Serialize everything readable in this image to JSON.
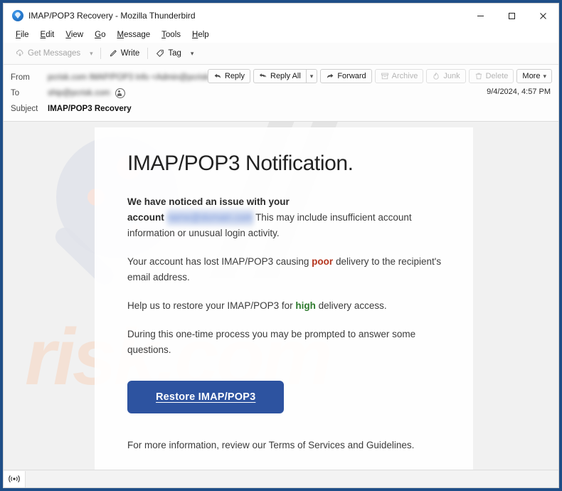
{
  "window": {
    "title": "IMAP/POP3 Recovery - Mozilla Thunderbird",
    "logo_icon": "thunderbird-logo-icon",
    "controls": {
      "minimize": "minimize-icon",
      "maximize": "maximize-icon",
      "close": "close-icon"
    }
  },
  "menubar": {
    "items": [
      {
        "label": "File",
        "mnemonic": "F",
        "rest": "ile"
      },
      {
        "label": "Edit",
        "mnemonic": "E",
        "rest": "dit"
      },
      {
        "label": "View",
        "mnemonic": "V",
        "rest": "iew"
      },
      {
        "label": "Go",
        "mnemonic": "G",
        "rest": "o"
      },
      {
        "label": "Message",
        "mnemonic": "M",
        "rest": "essage"
      },
      {
        "label": "Tools",
        "mnemonic": "T",
        "rest": "ools"
      },
      {
        "label": "Help",
        "mnemonic": "H",
        "rest": "elp"
      }
    ]
  },
  "toolbar": {
    "get_messages": "Get Messages",
    "get_messages_icon": "download-cloud-icon",
    "get_messages_chevron": "chevron-down-icon",
    "write": "Write",
    "write_icon": "pencil-icon",
    "tag": "Tag",
    "tag_icon": "tag-icon",
    "tag_chevron": "chevron-down-icon"
  },
  "message_header": {
    "from_label": "From",
    "from_value": "pcrisk.com IMAP/POP3 Info <Admin@pcrisk.com>",
    "to_label": "To",
    "to_value": "ship@pcrisk.com",
    "subject_label": "Subject",
    "subject_value": "IMAP/POP3 Recovery",
    "date": "9/4/2024, 4:57 PM",
    "contact_icon": "contact-person-icon",
    "actions": [
      {
        "label": "Reply",
        "icon": "reply-arrow-icon",
        "disabled": false
      },
      {
        "label": "Reply All",
        "icon": "reply-all-arrow-icon",
        "disabled": false
      },
      {
        "label": "",
        "icon": "chevron-down-icon",
        "disabled": false
      },
      {
        "label": "Forward",
        "icon": "forward-arrow-icon",
        "disabled": false
      },
      {
        "label": "Archive",
        "icon": "archive-box-icon",
        "disabled": true
      },
      {
        "label": "Junk",
        "icon": "junk-flame-icon",
        "disabled": true
      },
      {
        "label": "Delete",
        "icon": "trash-icon",
        "disabled": true
      },
      {
        "label": "More",
        "icon": "chevron-down-icon",
        "disabled": false
      }
    ]
  },
  "email": {
    "heading": "IMAP/POP3 Notification.",
    "p1_bold_a": "We have noticed an issue with your",
    "p1_bold_b": "account",
    "p1_blurred_address": "name@domain.com",
    "p1_rest": "This may include insufficient account information or unusual login activity.",
    "p2_a": "Your account has lost IMAP/POP3 causing",
    "p2_word": "poor",
    "p2_b": "delivery to the recipient's email address.",
    "p3_a": "Help us to restore your IMAP/POP3 for",
    "p3_word": "high",
    "p3_b": "delivery access.",
    "p4": "During this one-time process you may be prompted to answer some questions.",
    "cta_label": "Restore IMAP/POP3",
    "footer": "For more information, review our Terms of Services and Guidelines."
  },
  "watermarks": {
    "brand_mark": "//",
    "site_mark": "risk.com",
    "magnifier_icon": "magnifying-glass-watermark-icon"
  },
  "statusbar": {
    "connection_icon": "connection-signal-icon"
  },
  "colors": {
    "window_border": "#1f4e87",
    "cta_blue": "#2d53a0",
    "poor_red": "#b5361f",
    "high_green": "#2d7a2d"
  }
}
